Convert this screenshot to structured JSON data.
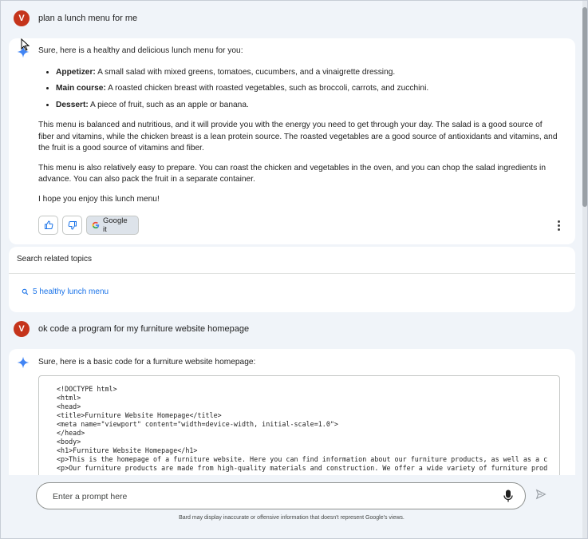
{
  "conversation": [
    {
      "user": {
        "avatar_letter": "V",
        "text": "plan a lunch menu for me"
      },
      "response": {
        "intro": "Sure, here is a healthy and delicious lunch menu for you:",
        "menu": [
          {
            "label": "Appetizer:",
            "text": " A small salad with mixed greens, tomatoes, cucumbers, and a vinaigrette dressing."
          },
          {
            "label": "Main course:",
            "text": " A roasted chicken breast with roasted vegetables, such as broccoli, carrots, and zucchini."
          },
          {
            "label": "Dessert:",
            "text": " A piece of fruit, such as an apple or banana."
          }
        ],
        "paragraphs": [
          "This menu is balanced and nutritious, and it will provide you with the energy you need to get through your day. The salad is a good source of fiber and vitamins, while the chicken breast is a lean protein source. The roasted vegetables are a good source of antioxidants and vitamins, and the fruit is a good source of vitamins and fiber.",
          "This menu is also relatively easy to prepare. You can roast the chicken and vegetables in the oven, and you can chop the salad ingredients in advance. You can also pack the fruit in a separate container.",
          "I hope you enjoy this lunch menu!"
        ],
        "actions": {
          "google_it_label": "Google it"
        },
        "related": {
          "title": "Search related topics",
          "items": [
            "5 healthy lunch menu"
          ]
        }
      }
    },
    {
      "user": {
        "avatar_letter": "V",
        "text": "ok code a program for my furniture website homepage"
      },
      "response": {
        "intro": "Sure, here is a basic code for a furniture website homepage:",
        "code_lines": [
          "<!DOCTYPE html>",
          "<html>",
          "<head>",
          "<title>Furniture Website Homepage</title>",
          "<meta name=\"viewport\" content=\"width=device-width, initial-scale=1.0\">",
          "</head>",
          "<body>",
          "<h1>Furniture Website Homepage</h1>",
          "<p>This is the homepage of a furniture website. Here you can find information about our furniture products, as well as a c",
          "<p>Our furniture products are made from high-quality materials and construction. We offer a wide variety of furniture prod"
        ]
      }
    }
  ],
  "prompt": {
    "placeholder": "Enter a prompt here"
  },
  "disclaimer": "Bard may display inaccurate or offensive information that doesn't represent Google's views.",
  "icons": {
    "spark": "sparkle-icon",
    "thumbs_up": "thumbs-up-icon",
    "thumbs_down": "thumbs-down-icon",
    "google": "google-g-icon",
    "more": "more-vert-icon",
    "search": "search-icon",
    "mic": "mic-icon",
    "send": "send-icon"
  },
  "colors": {
    "background": "#f0f4f9",
    "avatar": "#c5341b",
    "link": "#1a73e8",
    "spark": "#4285f4"
  }
}
